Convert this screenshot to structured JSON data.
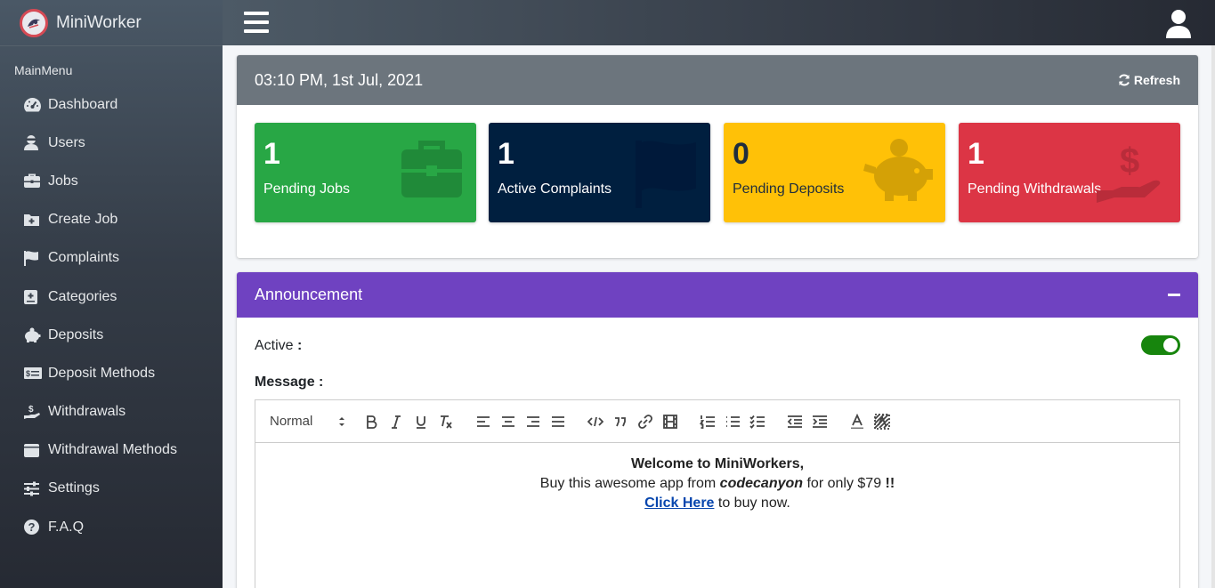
{
  "brand": {
    "name": "MiniWorker"
  },
  "sidebar": {
    "header": "MainMenu",
    "items": [
      {
        "label": "Dashboard",
        "icon": "dashboard-icon"
      },
      {
        "label": "Users",
        "icon": "user-icon"
      },
      {
        "label": "Jobs",
        "icon": "briefcase-icon"
      },
      {
        "label": "Create Job",
        "icon": "folder-plus-icon"
      },
      {
        "label": "Complaints",
        "icon": "flag-icon"
      },
      {
        "label": "Categories",
        "icon": "plus-square-icon"
      },
      {
        "label": "Deposits",
        "icon": "piggy-bank-icon"
      },
      {
        "label": "Deposit Methods",
        "icon": "money-bill-icon"
      },
      {
        "label": "Withdrawals",
        "icon": "hand-dollar-icon"
      },
      {
        "label": "Withdrawal Methods",
        "icon": "wallet-icon"
      },
      {
        "label": "Settings",
        "icon": "sliders-icon"
      },
      {
        "label": "F.A.Q",
        "icon": "question-circle-icon"
      }
    ]
  },
  "datetime_card": {
    "title": "03:10 PM, 1st Jul, 2021",
    "refresh_label": "Refresh"
  },
  "stats": [
    {
      "value": "1",
      "label": "Pending Jobs",
      "color": "#28a745",
      "icon": "briefcase-icon"
    },
    {
      "value": "1",
      "label": "Active Complaints",
      "color": "#001f3f",
      "icon": "flag-icon"
    },
    {
      "value": "0",
      "label": "Pending Deposits",
      "color": "#ffc107",
      "icon": "piggy-bank-icon"
    },
    {
      "value": "1",
      "label": "Pending Withdrawals",
      "color": "#dc3545",
      "icon": "hand-dollar-icon"
    }
  ],
  "announcement": {
    "title": "Announcement",
    "active_label": "Active",
    "active_colon": ":",
    "active": true,
    "message_label": "Message :",
    "editor": {
      "format_value": "Normal",
      "line1": "Welcome to MiniWorkers,",
      "line2_prefix": "Buy this awesome app from ",
      "line2_emph": "codecanyon",
      "line2_suffix": " for only $79 ",
      "line2_bang": "!!",
      "line3_link": "Click Here",
      "line3_suffix": " to buy now."
    }
  }
}
